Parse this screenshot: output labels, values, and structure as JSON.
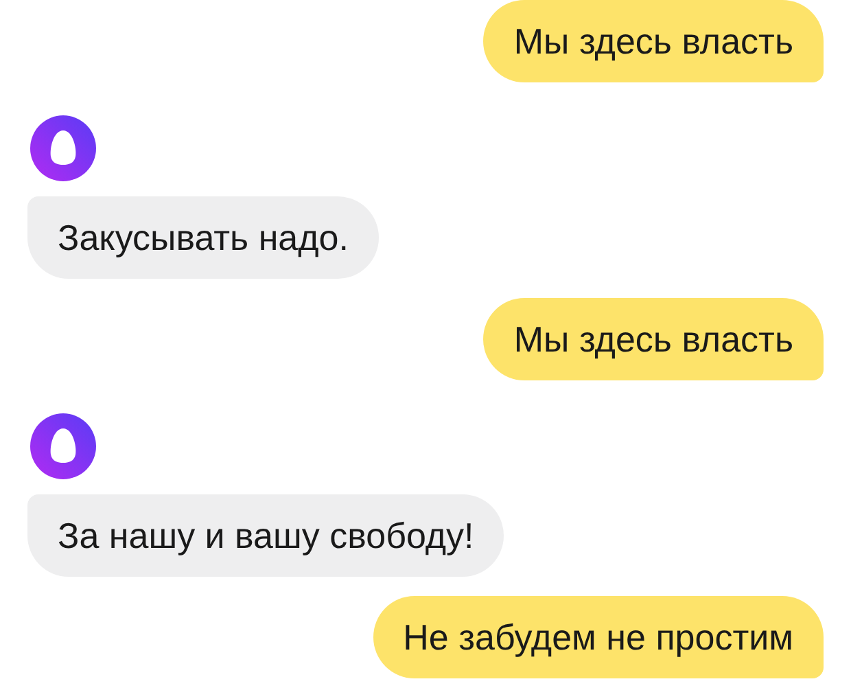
{
  "messages": [
    {
      "kind": "user",
      "text": "Мы здесь власть"
    },
    {
      "kind": "assistant",
      "text": "Закусывать надо."
    },
    {
      "kind": "user",
      "text": "Мы здесь власть"
    },
    {
      "kind": "assistant",
      "text": "За нашу и вашу свободу!"
    },
    {
      "kind": "user",
      "text": "Не забудем не простим"
    }
  ]
}
